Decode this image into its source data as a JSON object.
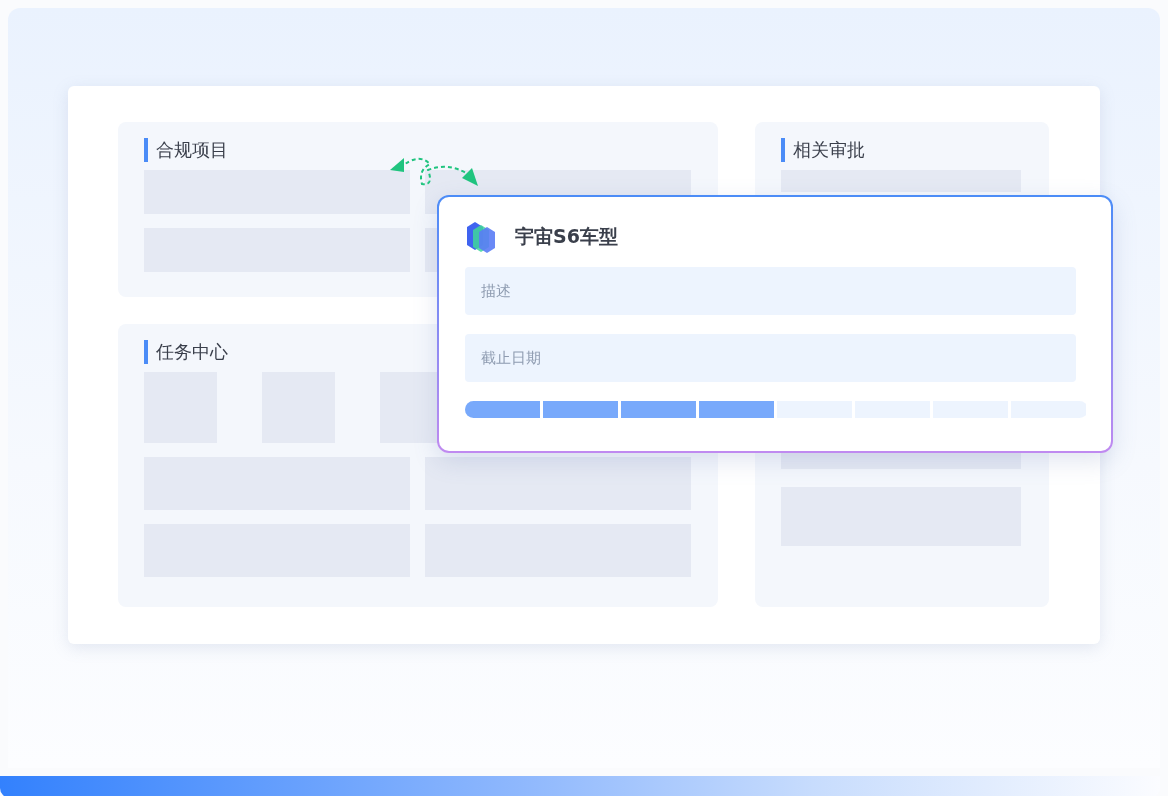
{
  "panels": [
    {
      "title": "合规项目"
    },
    {
      "title": "任务中心"
    },
    {
      "title": "相关审批"
    }
  ],
  "popup": {
    "title": "宇宙S6车型",
    "fields": [
      {
        "placeholder": "描述"
      },
      {
        "placeholder": "截止日期"
      }
    ],
    "progress": {
      "level": 0.5
    }
  }
}
